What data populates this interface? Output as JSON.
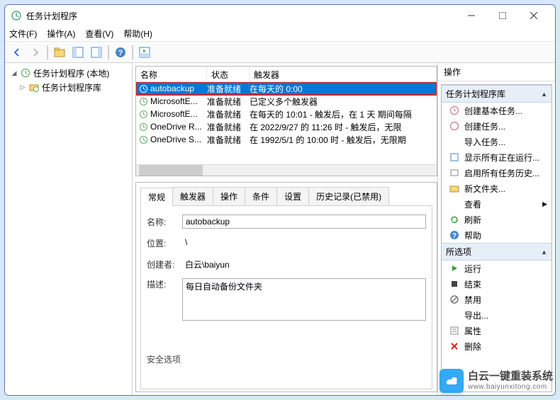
{
  "window": {
    "title": "任务计划程序"
  },
  "menu": {
    "file": "文件(F)",
    "action": "操作(A)",
    "view": "查看(V)",
    "help": "帮助(H)"
  },
  "tree": {
    "root": "任务计划程序 (本地)",
    "lib": "任务计划程序库"
  },
  "list": {
    "headers": {
      "name": "名称",
      "status": "状态",
      "trigger": "触发器"
    },
    "rows": [
      {
        "name": "autobackup",
        "status": "准备就绪",
        "trigger": "在每天的 0:00"
      },
      {
        "name": "MicrosoftE...",
        "status": "准备就绪",
        "trigger": "已定义多个触发器"
      },
      {
        "name": "MicrosoftE...",
        "status": "准备就绪",
        "trigger": "在每天的 10:01 - 触发后，在 1 天 期间每隔"
      },
      {
        "name": "OneDrive R...",
        "status": "准备就绪",
        "trigger": "在 2022/9/27 的 11:26 时 - 触发后，无限"
      },
      {
        "name": "OneDrive S...",
        "status": "准备就绪",
        "trigger": "在 1992/5/1 的 10:00 时 - 触发后，无限期"
      }
    ]
  },
  "tabs": {
    "general": "常规",
    "triggers": "触发器",
    "actions": "操作",
    "conditions": "条件",
    "settings": "设置",
    "history": "历史记录(已禁用)"
  },
  "details": {
    "name_label": "名称:",
    "name_value": "autobackup",
    "location_label": "位置:",
    "location_value": "\\",
    "creator_label": "创建者:",
    "creator_value": "白云\\baiyun",
    "desc_label": "描述:",
    "desc_value": "每日自动备份文件夹",
    "secopts": "安全选项"
  },
  "actions": {
    "title": "操作",
    "group1": "任务计划程序库",
    "items1": [
      {
        "icon": "create-basic",
        "label": "创建基本任务..."
      },
      {
        "icon": "create",
        "label": "创建任务..."
      },
      {
        "icon": "import",
        "label": "导入任务..."
      },
      {
        "icon": "running",
        "label": "显示所有正在运行..."
      },
      {
        "icon": "enable-history",
        "label": "启用所有任务历史..."
      },
      {
        "icon": "new-folder",
        "label": "新文件夹..."
      },
      {
        "icon": "view",
        "label": "查看",
        "arrow": true
      },
      {
        "icon": "refresh",
        "label": "刷新"
      },
      {
        "icon": "help",
        "label": "帮助"
      }
    ],
    "group2": "所选项",
    "items2": [
      {
        "icon": "run",
        "label": "运行"
      },
      {
        "icon": "end",
        "label": "结束"
      },
      {
        "icon": "disable",
        "label": "禁用"
      },
      {
        "icon": "export",
        "label": "导出..."
      },
      {
        "icon": "props",
        "label": "属性"
      },
      {
        "icon": "delete",
        "label": "删除"
      }
    ]
  },
  "watermark": {
    "line1": "白云一键重装系统",
    "line2": "www.baiyunxitong.com"
  }
}
